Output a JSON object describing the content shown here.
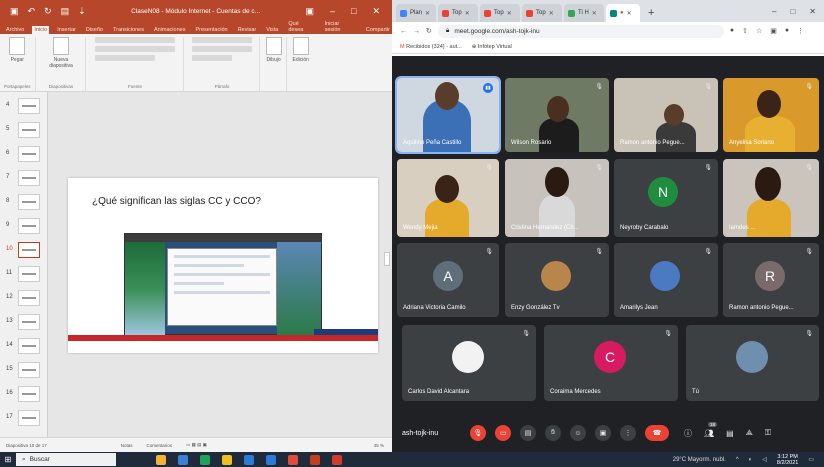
{
  "powerpoint": {
    "window_title": "ClaseN08 - Módulo Internet - Cuentas de c...",
    "tabs": [
      "Archivo",
      "Inicio",
      "Insertar",
      "Diseño",
      "Transiciones",
      "Animaciones",
      "Presentación",
      "Revisar",
      "Vista",
      "Qué desea",
      "Iniciar sesión",
      "Compartir"
    ],
    "ribbon": {
      "paste_label": "Pegar",
      "new_slide_label": "Nueva diapositiva",
      "draw_label": "Dibujo",
      "edit_label": "Edición",
      "groups": [
        "Portapapeles",
        "Diapositivas",
        "Fuente",
        "Párrafo"
      ]
    },
    "thumbnails": [
      "4",
      "5",
      "6",
      "7",
      "8",
      "9",
      "10",
      "11",
      "12",
      "13",
      "14",
      "15",
      "16",
      "17"
    ],
    "active_thumbnail": "10",
    "slide": {
      "title": "¿Qué significan las siglas CC y CCO?"
    },
    "status": {
      "slide_info": "Diapositiva 10 de 17",
      "notes": "Notas",
      "comments": "Comentarios",
      "zoom": "45 %"
    }
  },
  "browser": {
    "tabs": [
      {
        "label": "Plan",
        "icon_color": "#4285f4"
      },
      {
        "label": "Top",
        "icon_color": "#ea4335"
      },
      {
        "label": "Top",
        "icon_color": "#ea4335"
      },
      {
        "label": "Top",
        "icon_color": "#ea4335"
      },
      {
        "label": "Ti H",
        "icon_color": "#34a853"
      },
      {
        "label": "",
        "icon_color": "#00897b"
      }
    ],
    "new_tab": "+",
    "url": "meet.google.com/ash-tojk-inu",
    "bookmarks": [
      "Recibidos (324) - aut...",
      "Infotep Virtual"
    ]
  },
  "meet": {
    "accent": "#8ab4f8",
    "participants": [
      {
        "name": "Aquilino Peña Castillo",
        "speaking": true
      },
      {
        "name": "Wilson Rosario"
      },
      {
        "name": "Ramon antonio Pegue..."
      },
      {
        "name": "Anyelisa Soriano"
      },
      {
        "name": "Wendy Mejia"
      },
      {
        "name": "Cristina Hernandez (Ch..."
      },
      {
        "name": "Neyroby Carabalo",
        "initial": "N",
        "color": "#1e8e3e"
      },
      {
        "name": "Iamdes ..."
      },
      {
        "name": "Adriana Victoria Camilo",
        "initial": "A",
        "color": "#5f6f7a"
      },
      {
        "name": "Enzy González Tv"
      },
      {
        "name": "Amarilys Jean"
      },
      {
        "name": "Ramon antonio Pegue...",
        "initial": "R",
        "color": "#7a6a6a"
      },
      {
        "name": "Carlos David Alcantara"
      },
      {
        "name": "Coraima Mercedes",
        "initial": "C",
        "color": "#d81b60"
      },
      {
        "name": "Tú"
      }
    ],
    "meeting_code": "ash-tojk-inu",
    "participant_count": "18"
  },
  "taskbar": {
    "search_placeholder": "Buscar",
    "weather": "29°C Mayorm. nubl.",
    "time": "3:12 PM",
    "date": "8/2/2021"
  }
}
